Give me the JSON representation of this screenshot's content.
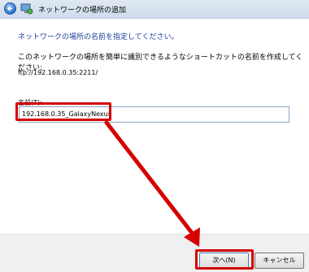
{
  "window": {
    "title": "ネットワークの場所の追加",
    "back_icon": "back-arrow-icon",
    "app_icon": "network-location-icon"
  },
  "main": {
    "heading": "ネットワークの場所の名前を指定してください。",
    "description": "このネットワークの場所を簡単に識別できるようなショートカットの名前を作成してください:",
    "url": "ftp://192.168.0.35:2211/",
    "name_label": "名前(T):",
    "name_value": "192.168.0.35_GalaxyNexus"
  },
  "footer": {
    "next_label": "次へ(N)",
    "cancel_label": "キャンセル"
  },
  "colors": {
    "highlight": "#d60000",
    "heading": "#1f3f9a"
  }
}
